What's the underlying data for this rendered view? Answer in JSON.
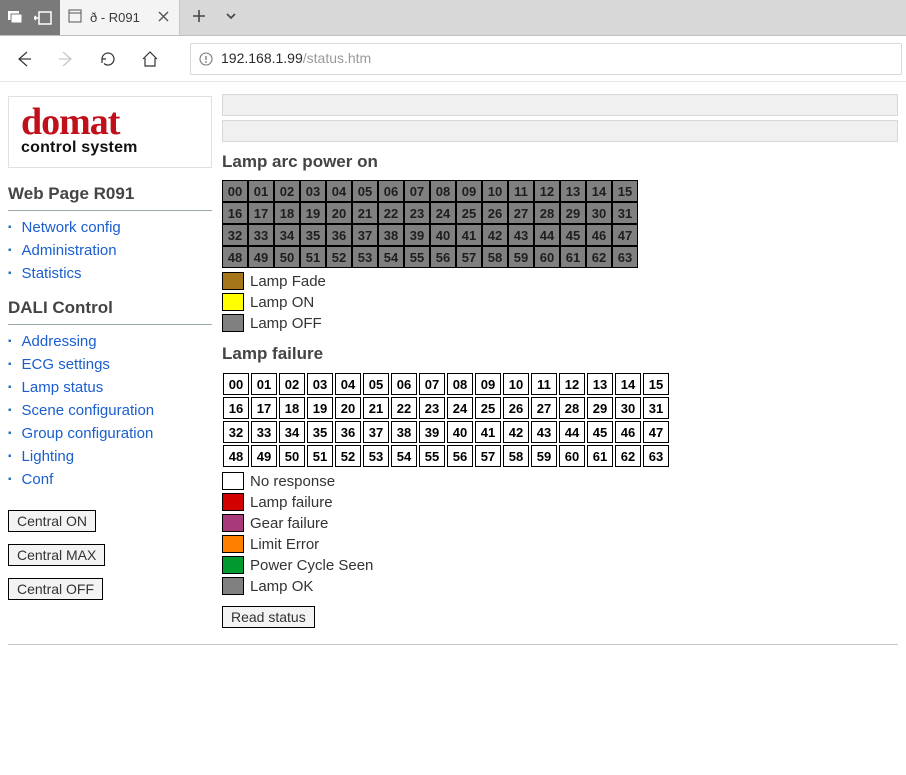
{
  "browser": {
    "tab_title": "ð - R091",
    "url_host": "192.168.1.99",
    "url_path": "/status.htm"
  },
  "logo": {
    "line1": "domat",
    "line2": "control system"
  },
  "sidebar": {
    "section1": {
      "title": "Web Page R091",
      "items": [
        "Network config",
        "Administration",
        "Statistics"
      ]
    },
    "section2": {
      "title": "DALI Control",
      "items": [
        "Addressing",
        "ECG settings",
        "Lamp status",
        "Scene configuration",
        "Group configuration",
        "Lighting",
        "Conf"
      ]
    },
    "buttons": [
      "Central ON",
      "Central MAX",
      "Central OFF"
    ]
  },
  "arc": {
    "title": "Lamp arc power on",
    "cells": [
      "00",
      "01",
      "02",
      "03",
      "04",
      "05",
      "06",
      "07",
      "08",
      "09",
      "10",
      "11",
      "12",
      "13",
      "14",
      "15",
      "16",
      "17",
      "18",
      "19",
      "20",
      "21",
      "22",
      "23",
      "24",
      "25",
      "26",
      "27",
      "28",
      "29",
      "30",
      "31",
      "32",
      "33",
      "34",
      "35",
      "36",
      "37",
      "38",
      "39",
      "40",
      "41",
      "42",
      "43",
      "44",
      "45",
      "46",
      "47",
      "48",
      "49",
      "50",
      "51",
      "52",
      "53",
      "54",
      "55",
      "56",
      "57",
      "58",
      "59",
      "60",
      "61",
      "62",
      "63"
    ],
    "legend": [
      {
        "label": "Lamp Fade",
        "color": "#a6761b"
      },
      {
        "label": "Lamp ON",
        "color": "#ffff00"
      },
      {
        "label": "Lamp OFF",
        "color": "#808080"
      }
    ]
  },
  "failure": {
    "title": "Lamp failure",
    "cells": [
      "00",
      "01",
      "02",
      "03",
      "04",
      "05",
      "06",
      "07",
      "08",
      "09",
      "10",
      "11",
      "12",
      "13",
      "14",
      "15",
      "16",
      "17",
      "18",
      "19",
      "20",
      "21",
      "22",
      "23",
      "24",
      "25",
      "26",
      "27",
      "28",
      "29",
      "30",
      "31",
      "32",
      "33",
      "34",
      "35",
      "36",
      "37",
      "38",
      "39",
      "40",
      "41",
      "42",
      "43",
      "44",
      "45",
      "46",
      "47",
      "48",
      "49",
      "50",
      "51",
      "52",
      "53",
      "54",
      "55",
      "56",
      "57",
      "58",
      "59",
      "60",
      "61",
      "62",
      "63"
    ],
    "legend": [
      {
        "label": "No response",
        "color": "#ffffff"
      },
      {
        "label": "Lamp failure",
        "color": "#d30000"
      },
      {
        "label": "Gear failure",
        "color": "#a83a7b"
      },
      {
        "label": "Limit Error",
        "color": "#ff7f00"
      },
      {
        "label": "Power Cycle Seen",
        "color": "#009a2e"
      },
      {
        "label": "Lamp OK",
        "color": "#808080"
      }
    ]
  },
  "read_button": "Read status"
}
